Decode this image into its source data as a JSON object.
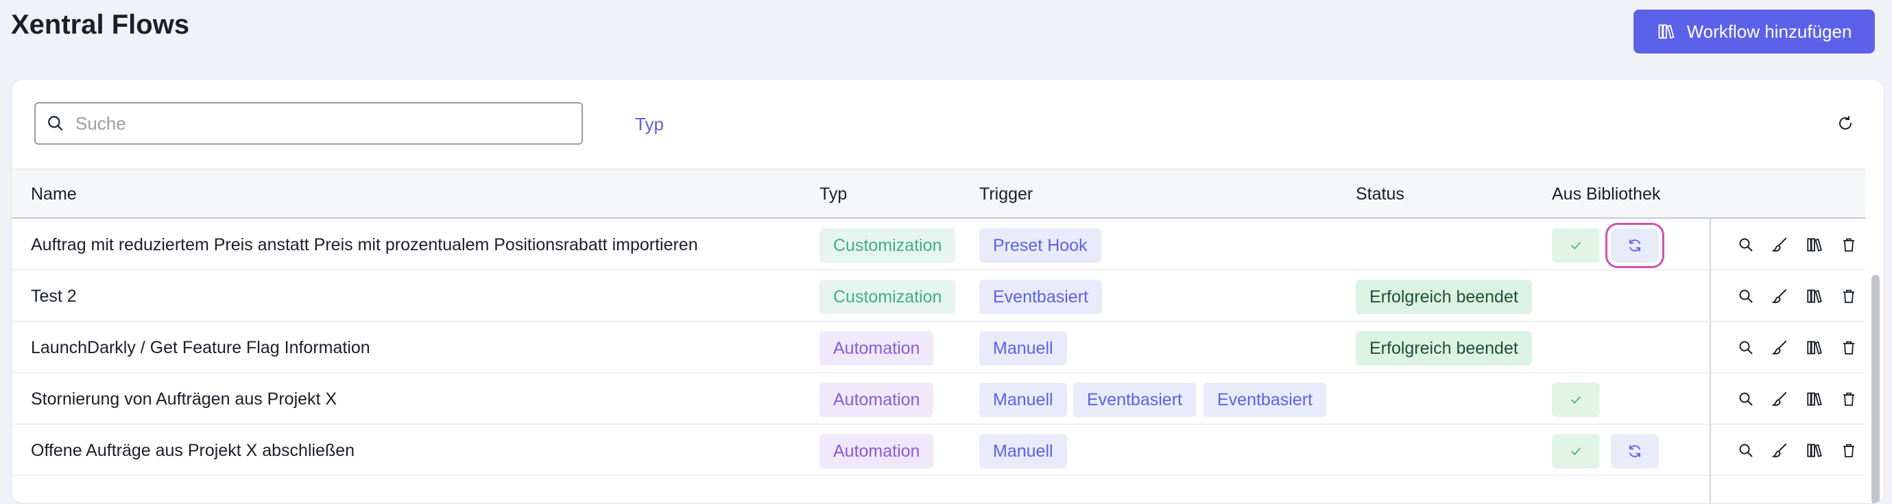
{
  "page": {
    "title": "Xentral Flows"
  },
  "header": {
    "add_button_label": "Workflow hinzufügen"
  },
  "toolbar": {
    "search_placeholder": "Suche",
    "search_value": "",
    "filter_type_label": "Typ"
  },
  "table": {
    "columns": {
      "name": "Name",
      "typ": "Typ",
      "trigger": "Trigger",
      "status": "Status",
      "aus_bibliothek": "Aus Bibliothek"
    },
    "rows": [
      {
        "name": "Auftrag mit reduziertem Preis anstatt Preis mit prozentualem Positionsrabatt importieren",
        "typ": "Customization",
        "triggers": [
          "Preset Hook"
        ],
        "status": "",
        "library_ok": true,
        "library_sync": true,
        "sync_focused": true
      },
      {
        "name": "Test 2",
        "typ": "Customization",
        "triggers": [
          "Eventbasiert"
        ],
        "status": "Erfolgreich beendet",
        "library_ok": false,
        "library_sync": false
      },
      {
        "name": "LaunchDarkly / Get Feature Flag Information",
        "typ": "Automation",
        "triggers": [
          "Manuell"
        ],
        "status": "Erfolgreich beendet",
        "library_ok": false,
        "library_sync": false
      },
      {
        "name": "Stornierung von Aufträgen aus Projekt X",
        "typ": "Automation",
        "triggers": [
          "Manuell",
          "Eventbasiert",
          "Eventbasiert"
        ],
        "status": "",
        "library_ok": true,
        "library_sync": false
      },
      {
        "name": "Offene Aufträge aus Projekt X abschließen",
        "typ": "Automation",
        "triggers": [
          "Manuell"
        ],
        "status": "",
        "library_ok": true,
        "library_sync": true
      }
    ]
  },
  "icons": {
    "search": "search-icon",
    "refresh": "refresh-icon",
    "library": "library-books-icon",
    "check": "check-icon",
    "sync": "sync-icon",
    "view": "magnifier-icon",
    "edit": "brush-icon",
    "delete": "trash-icon"
  },
  "colors": {
    "primary": "#5b61e9",
    "customization_bg": "#e6f5ef",
    "customization_text": "#3fae84",
    "automation_bg": "#efe9fb",
    "automation_text": "#8a5ad6",
    "trigger_bg": "#e9ebfa",
    "success_bg": "#dcf3e4",
    "focus_ring": "#d44fb4"
  }
}
